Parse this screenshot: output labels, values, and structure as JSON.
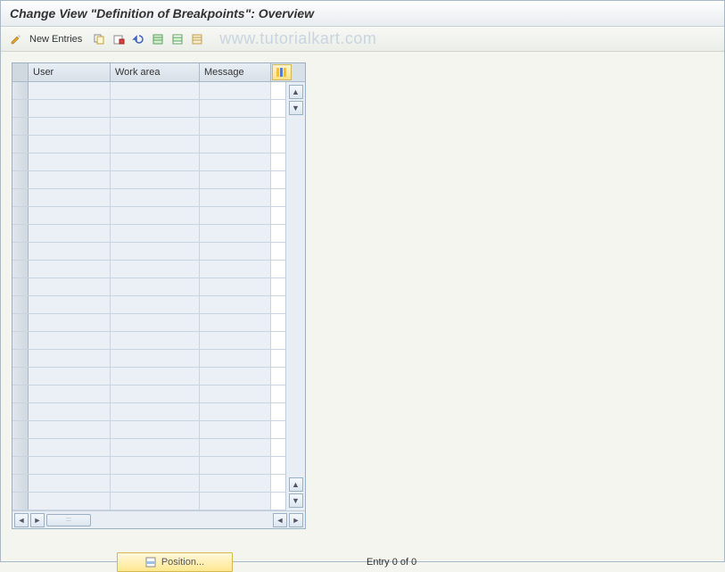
{
  "title": "Change View \"Definition of Breakpoints\": Overview",
  "toolbar": {
    "new_entries_label": "New Entries"
  },
  "watermark": "www.tutorialkart.com",
  "table": {
    "columns": {
      "user": "User",
      "work_area": "Work area",
      "message": "Message"
    },
    "row_count": 24
  },
  "footer": {
    "position_label": "Position...",
    "entry_label": "Entry 0 of 0"
  }
}
